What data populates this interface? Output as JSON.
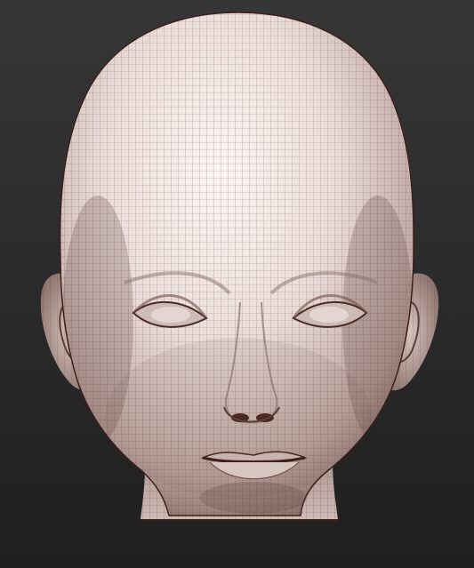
{
  "viewport": {
    "background_top": "#363636",
    "background_bottom": "#1f1f1f"
  },
  "model": {
    "subject": "head",
    "material": {
      "base_color": "#e9dcd8",
      "highlight_color": "#fbf5f3",
      "shadow_color": "#7b625e",
      "wire_color": "#6f3b35",
      "dark_edge_color": "#3e1f1b"
    },
    "wireframe_visible": true
  }
}
